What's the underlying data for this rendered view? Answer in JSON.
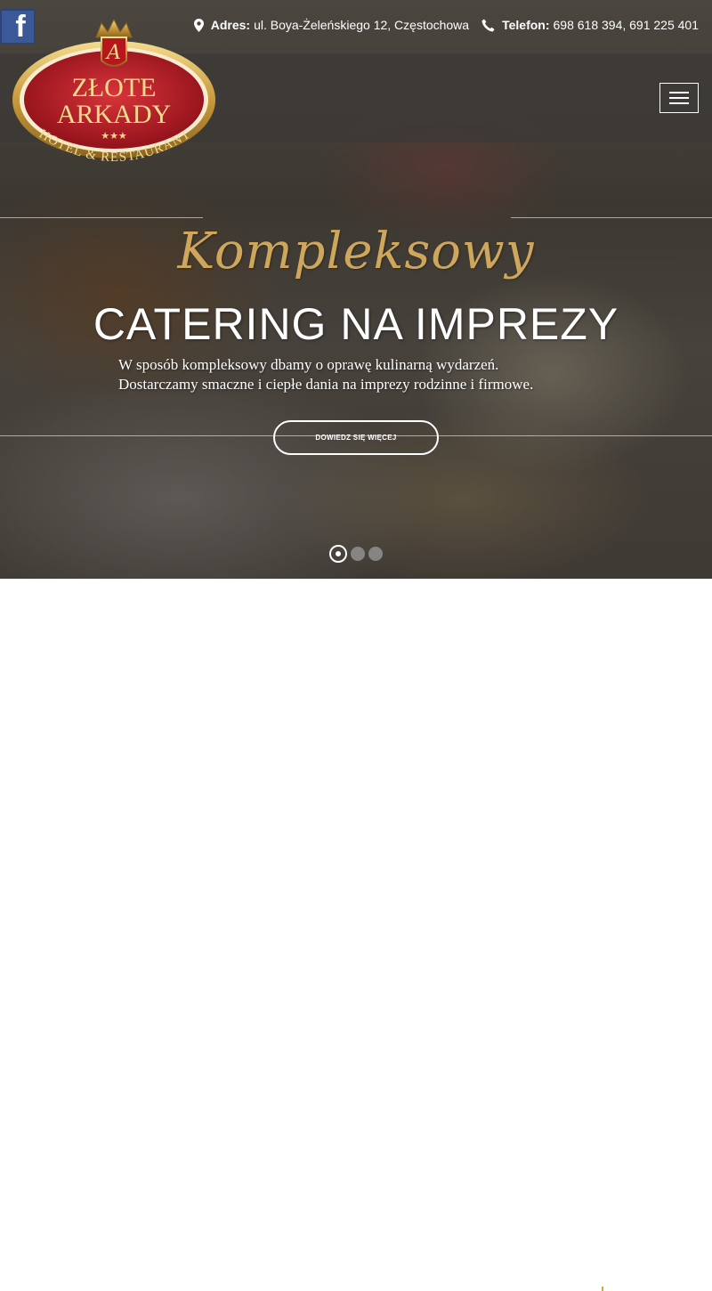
{
  "topbar": {
    "facebook_icon": "facebook-icon",
    "address": {
      "label": "Adres:",
      "value": "ul. Boya-Żeleńskiego 12, Częstochowa",
      "icon": "map-marker-icon"
    },
    "phone": {
      "label": "Telefon:",
      "value": "698 618 394, 691 225 401",
      "icon": "phone-icon"
    }
  },
  "logo": {
    "monogram": "A",
    "line1": "ZŁOTE",
    "line2": "ARKADY",
    "stars": "★★★",
    "tagline": "HOTEL & RESTAURANT"
  },
  "slide": {
    "script_text": "Kompleksowy",
    "title": "CATERING NA IMPREZY",
    "description_line1": "W sposób kompleksowy dbamy o oprawę kulinarną wydarzeń.",
    "description_line2": "Dostarczamy smaczne i ciepłe dania na imprezy rodzinne i firmowe.",
    "button_label": "DOWIEDZ SIĘ WIĘCEJ",
    "active_index": 1,
    "total": 3
  },
  "colors": {
    "gold": "#cfa75c",
    "logo_red": "#c0202a",
    "facebook_blue": "#3b5998"
  }
}
